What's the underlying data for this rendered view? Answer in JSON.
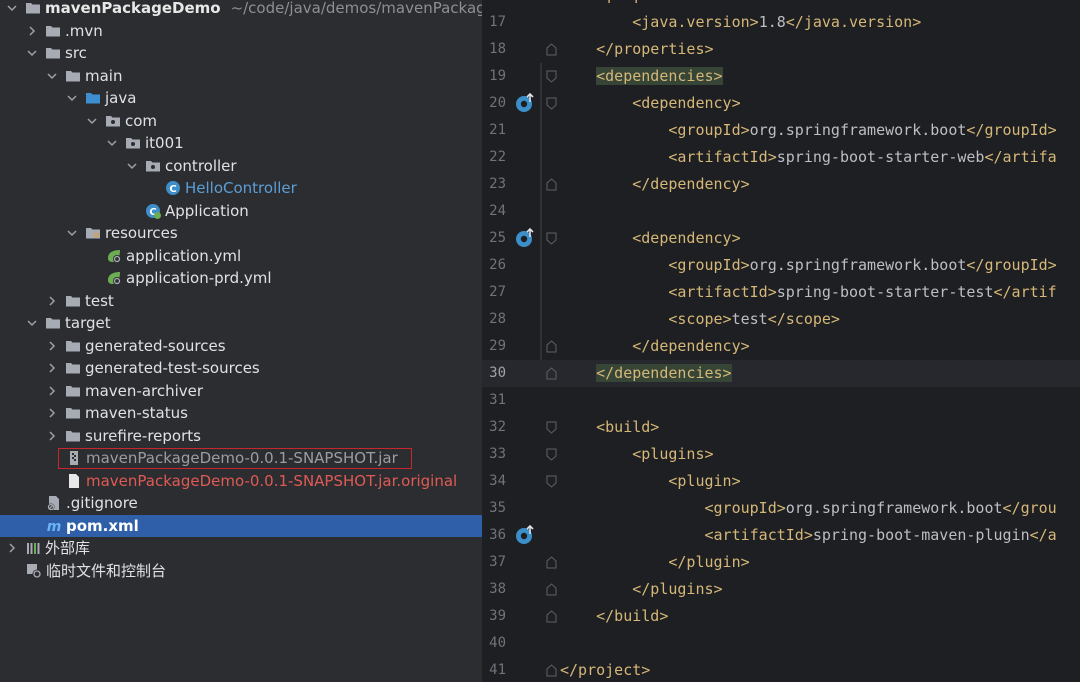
{
  "project": {
    "root_name": "mavenPackageDemo",
    "root_path": "~/code/java/demos/mavenPackageDe"
  },
  "tree": {
    "mvn": ".mvn",
    "src": "src",
    "main": "main",
    "java": "java",
    "com": "com",
    "it001": "it001",
    "controller": "controller",
    "hello_controller": "HelloController",
    "application": "Application",
    "resources": "resources",
    "application_yml": "application.yml",
    "application_prd_yml": "application-prd.yml",
    "test": "test",
    "target": "target",
    "generated_sources": "generated-sources",
    "generated_test_sources": "generated-test-sources",
    "maven_archiver": "maven-archiver",
    "maven_status": "maven-status",
    "surefire_reports": "surefire-reports",
    "snapshot_jar": "mavenPackageDemo-0.0.1-SNAPSHOT.jar",
    "snapshot_jar_original": "mavenPackageDemo-0.0.1-SNAPSHOT.jar.original",
    "gitignore": ".gitignore",
    "pom": "pom.xml",
    "external_libs": "外部库",
    "scratches": "临时文件和控制台"
  },
  "editor": {
    "current_line": "30",
    "lines": [
      {
        "num": "17",
        "indent": "        ",
        "open": "<java.version>",
        "text": "1.8",
        "close": "</java.version>"
      },
      {
        "num": "18",
        "indent": "    ",
        "open": "</properties>",
        "text": "",
        "close": ""
      },
      {
        "num": "19",
        "indent": "    ",
        "open": "<dependencies>",
        "text": "",
        "close": ""
      },
      {
        "num": "20",
        "indent": "        ",
        "open": "<dependency>",
        "text": "",
        "close": ""
      },
      {
        "num": "21",
        "indent": "            ",
        "open": "<groupId>",
        "text": "org.springframework.boot",
        "close": "</groupId>"
      },
      {
        "num": "22",
        "indent": "            ",
        "open": "<artifactId>",
        "text": "spring-boot-starter-web",
        "close": "</artifa"
      },
      {
        "num": "23",
        "indent": "        ",
        "open": "</dependency>",
        "text": "",
        "close": ""
      },
      {
        "num": "24",
        "indent": "",
        "open": "",
        "text": "",
        "close": ""
      },
      {
        "num": "25",
        "indent": "        ",
        "open": "<dependency>",
        "text": "",
        "close": ""
      },
      {
        "num": "26",
        "indent": "            ",
        "open": "<groupId>",
        "text": "org.springframework.boot",
        "close": "</groupId>"
      },
      {
        "num": "27",
        "indent": "            ",
        "open": "<artifactId>",
        "text": "spring-boot-starter-test",
        "close": "</artif"
      },
      {
        "num": "28",
        "indent": "            ",
        "open": "<scope>",
        "text": "test",
        "close": "</scope>"
      },
      {
        "num": "29",
        "indent": "        ",
        "open": "</dependency>",
        "text": "",
        "close": ""
      },
      {
        "num": "30",
        "indent": "    ",
        "open": "</dependencies>",
        "text": "",
        "close": ""
      },
      {
        "num": "31",
        "indent": "",
        "open": "",
        "text": "",
        "close": ""
      },
      {
        "num": "32",
        "indent": "    ",
        "open": "<build>",
        "text": "",
        "close": ""
      },
      {
        "num": "33",
        "indent": "        ",
        "open": "<plugins>",
        "text": "",
        "close": ""
      },
      {
        "num": "34",
        "indent": "            ",
        "open": "<plugin>",
        "text": "",
        "close": ""
      },
      {
        "num": "35",
        "indent": "                ",
        "open": "<groupId>",
        "text": "org.springframework.boot",
        "close": "</grou"
      },
      {
        "num": "36",
        "indent": "                ",
        "open": "<artifactId>",
        "text": "spring-boot-maven-plugin",
        "close": "</a"
      },
      {
        "num": "37",
        "indent": "            ",
        "open": "</plugin>",
        "text": "",
        "close": ""
      },
      {
        "num": "38",
        "indent": "        ",
        "open": "</plugins>",
        "text": "",
        "close": ""
      },
      {
        "num": "39",
        "indent": "    ",
        "open": "</build>",
        "text": "",
        "close": ""
      },
      {
        "num": "40",
        "indent": "",
        "open": "",
        "text": "",
        "close": ""
      },
      {
        "num": "41",
        "indent": "",
        "open": "</project>",
        "text": "",
        "close": ""
      }
    ]
  },
  "colors": {
    "tag": "#d5b778",
    "text": "#bcbec4",
    "selection": "#2e5fa8",
    "error_file": "#e05a55",
    "class_link": "#5c9ed6",
    "highlight_box": "#c8262b"
  },
  "icons": [
    "chevron-down-icon",
    "chevron-right-icon",
    "folder-icon",
    "source-folder-icon",
    "package-icon",
    "class-icon",
    "spring-boot-app-icon",
    "resources-folder-icon",
    "spring-yaml-icon",
    "jar-icon",
    "file-icon",
    "gitignore-icon",
    "maven-icon",
    "libraries-icon",
    "scratches-icon",
    "override-gutter-icon",
    "fold-marker-icon"
  ]
}
